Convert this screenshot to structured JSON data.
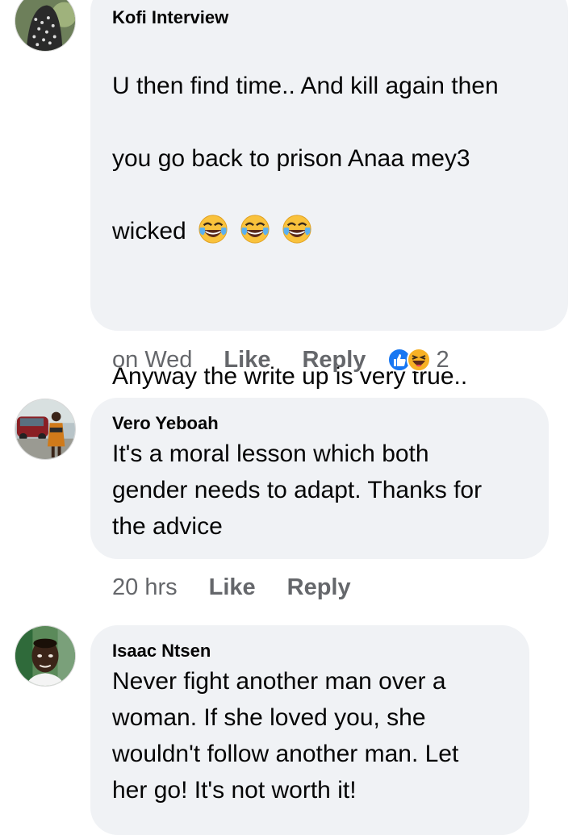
{
  "comments": [
    {
      "author": "Kofi Interview",
      "text_lines": [
        "U then find time.. And kill again then",
        "you go back to prison Anaa mey3",
        "wicked"
      ],
      "text_after": "Anyway the write up is very true..\nWhen you see ur partner cheating\nlet him or her go.. It hurts but u\ngonna be healed",
      "emojis": [
        "laughing-tears-emoji",
        "laughing-tears-emoji",
        "laughing-tears-emoji"
      ],
      "time": "on Wed",
      "like_label": "Like",
      "reply_label": "Reply",
      "reactions": [
        "like-reaction",
        "haha-reaction"
      ],
      "reaction_count": "2"
    },
    {
      "author": "Vero Yeboah",
      "text": "It's a moral lesson which both\ngender needs to adapt. Thanks for\nthe advice",
      "time": "20 hrs",
      "like_label": "Like",
      "reply_label": "Reply"
    },
    {
      "author": "Isaac Ntsen",
      "text": "Never fight another man over a\nwoman. If she loved you, she\nwouldn't follow another man. Let\nher go! It's not worth it!"
    }
  ],
  "colors": {
    "bubble": "#f0f2f5",
    "meta_text": "#65676b",
    "like_blue": "#1877f2",
    "haha_yellow": "#f7b125"
  }
}
